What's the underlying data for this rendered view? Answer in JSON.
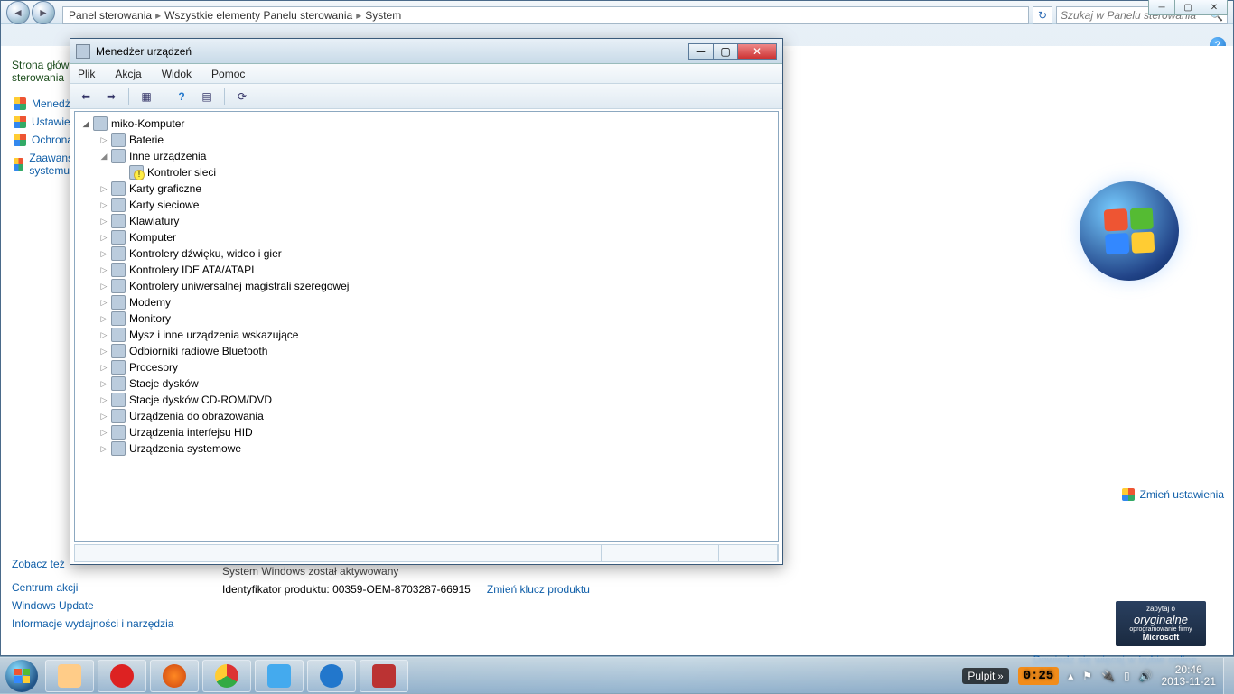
{
  "bg": {
    "breadcrumb": [
      "Panel sterowania",
      "Wszystkie elementy Panelu sterowania",
      "System"
    ],
    "search_placeholder": "Szukaj w Panelu sterowania",
    "left_head": "Strona główna Panelu sterowania",
    "left_items": [
      "Menedżer urządzeń",
      "Ustawienia zdalne",
      "Ochrona systemu",
      "Zaawansowane ustawienia systemu"
    ],
    "seealso_head": "Zobacz też",
    "seealso": [
      "Centrum akcji",
      "Windows Update",
      "Informacje wydajności i narzędzia"
    ],
    "activated": "System Windows został aktywowany",
    "product_id_label": "Identyfikator produktu:",
    "product_id": "00359-OEM-8703287-66915",
    "change_key": "Zmień klucz produktu",
    "change_settings": "Zmień ustawienia",
    "genuine_top": "zapytaj o",
    "genuine_main": "oryginalne",
    "genuine_sub": "oprogramowanie firmy",
    "genuine_ms": "Microsoft",
    "online": "Dowiedz się więcej w trybie online..."
  },
  "dm": {
    "title": "Menedżer urządzeń",
    "menu": [
      "Plik",
      "Akcja",
      "Widok",
      "Pomoc"
    ],
    "root": "miko-Komputer",
    "nodes": [
      {
        "label": "Baterie",
        "expanded": false
      },
      {
        "label": "Inne urządzenia",
        "expanded": true,
        "children": [
          {
            "label": "Kontroler sieci",
            "warn": true
          }
        ]
      },
      {
        "label": "Karty graficzne",
        "expanded": false
      },
      {
        "label": "Karty sieciowe",
        "expanded": false
      },
      {
        "label": "Klawiatury",
        "expanded": false
      },
      {
        "label": "Komputer",
        "expanded": false
      },
      {
        "label": "Kontrolery dźwięku, wideo i gier",
        "expanded": false
      },
      {
        "label": "Kontrolery IDE ATA/ATAPI",
        "expanded": false
      },
      {
        "label": "Kontrolery uniwersalnej magistrali szeregowej",
        "expanded": false
      },
      {
        "label": "Modemy",
        "expanded": false
      },
      {
        "label": "Monitory",
        "expanded": false
      },
      {
        "label": "Mysz i inne urządzenia wskazujące",
        "expanded": false
      },
      {
        "label": "Odbiorniki radiowe Bluetooth",
        "expanded": false
      },
      {
        "label": "Procesory",
        "expanded": false
      },
      {
        "label": "Stacje dysków",
        "expanded": false
      },
      {
        "label": "Stacje dysków CD-ROM/DVD",
        "expanded": false
      },
      {
        "label": "Urządzenia do obrazowania",
        "expanded": false
      },
      {
        "label": "Urządzenia interfejsu HID",
        "expanded": false
      },
      {
        "label": "Urządzenia systemowe",
        "expanded": false
      }
    ]
  },
  "taskbar": {
    "pulpit": "Pulpit",
    "timer": "0:25",
    "time": "20:46",
    "date": "2013-11-21"
  }
}
